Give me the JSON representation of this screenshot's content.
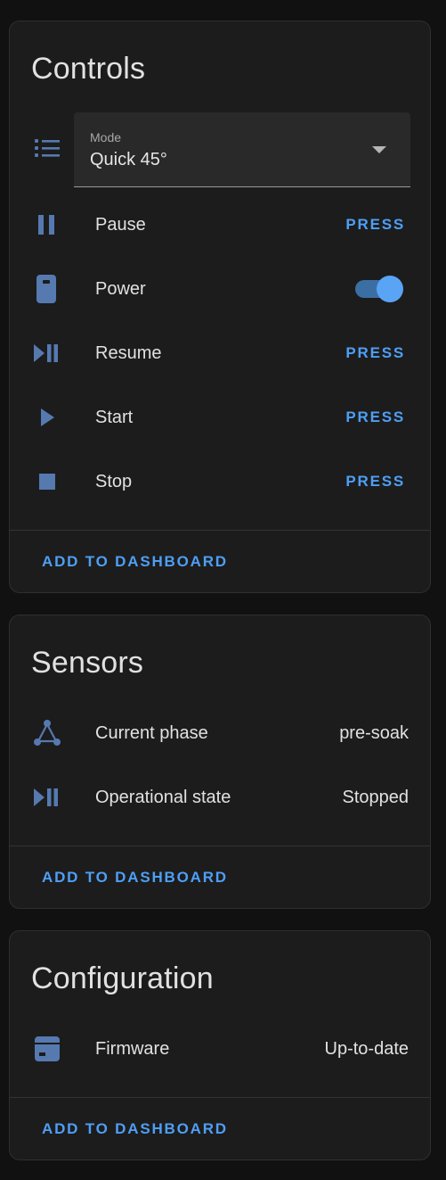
{
  "colors": {
    "background": "#111111",
    "card": "#1c1c1c",
    "accent": "#4e9ff5",
    "icon": "#5679b0",
    "text": "#e1e1e1"
  },
  "controls": {
    "title": "Controls",
    "mode": {
      "label": "Mode",
      "value": "Quick 45°",
      "icon": "format-list-bulleted-icon"
    },
    "rows": [
      {
        "label": "Pause",
        "action": "PRESS",
        "icon": "pause-icon"
      },
      {
        "label": "Power",
        "toggle_on": true,
        "icon": "power-device-icon"
      },
      {
        "label": "Resume",
        "action": "PRESS",
        "icon": "play-pause-icon"
      },
      {
        "label": "Start",
        "action": "PRESS",
        "icon": "play-icon"
      },
      {
        "label": "Stop",
        "action": "PRESS",
        "icon": "stop-icon"
      }
    ],
    "add_label": "ADD TO DASHBOARD"
  },
  "sensors": {
    "title": "Sensors",
    "rows": [
      {
        "label": "Current phase",
        "value": "pre-soak",
        "icon": "state-machine-icon"
      },
      {
        "label": "Operational state",
        "value": "Stopped",
        "icon": "play-pause-icon"
      }
    ],
    "add_label": "ADD TO DASHBOARD"
  },
  "configuration": {
    "title": "Configuration",
    "rows": [
      {
        "label": "Firmware",
        "value": "Up-to-date",
        "icon": "package-icon"
      }
    ],
    "add_label": "ADD TO DASHBOARD"
  }
}
